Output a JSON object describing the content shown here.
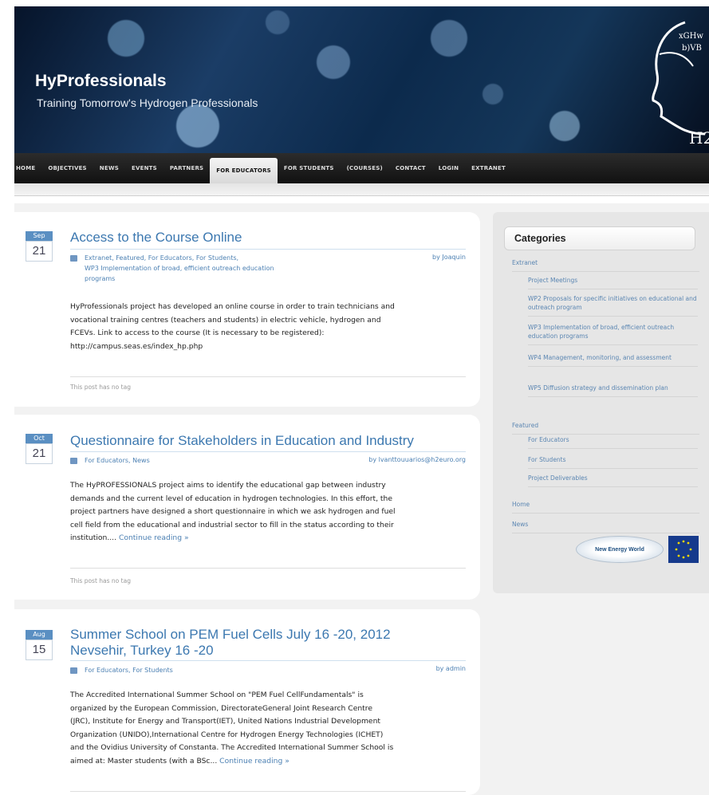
{
  "site": {
    "title": "HyProfessionals",
    "tagline": "Training Tomorrow's Hydrogen Professionals"
  },
  "nav": {
    "items": [
      {
        "label": "HOME",
        "active": false
      },
      {
        "label": "OBJECTIVES",
        "active": false
      },
      {
        "label": "NEWS",
        "active": false
      },
      {
        "label": "EVENTS",
        "active": false
      },
      {
        "label": "PARTNERS",
        "active": false
      },
      {
        "label": "FOR EDUCATORS",
        "active": true
      },
      {
        "label": "FOR STUDENTS",
        "active": false
      },
      {
        "label": "(COURSES)",
        "active": false
      },
      {
        "label": "CONTACT",
        "active": false
      },
      {
        "label": "LOGIN",
        "active": false
      },
      {
        "label": "EXTRANET",
        "active": false
      }
    ]
  },
  "posts": [
    {
      "month": "Sep",
      "day": "21",
      "title": "Access to the Course Online",
      "categories_line1": "Extranet, Featured, For Educators, For Students,",
      "categories_line2": "WP3 Implementation of broad, efficient outreach education",
      "categories_line3": "programs",
      "author": "by Joaquin",
      "body_line1": "HyProfessionals project has developed an online course in order to train technicians and",
      "body_line2": "vocational training centres (teachers and students) in electric vehicle, hydrogen and",
      "body_line3": "FCEVs. Link to access to the course (It is necessary to be registered):",
      "body_line4": "http://campus.seas.es/index_hp.php",
      "tags": "This post has no tag"
    },
    {
      "month": "Oct",
      "day": "21",
      "title": "Questionnaire for Stakeholders in Education and Industry",
      "categories": "For Educators, News",
      "author": "by lvanttouuarios@h2euro.org",
      "body_line1": "The HyPROFESSIONALS project  aims to identify the educational gap between industry",
      "body_line2": "demands and the current level of education in hydrogen technologies. In this effort, the",
      "body_line3": "project partners have designed a short questionnaire in which we ask hydrogen and fuel",
      "body_line4": "cell field from the educational and industrial sector to fill in the status according to their",
      "body_line5": "institution....",
      "more": "Continue reading »",
      "tags": "This post has no tag"
    },
    {
      "month": "Aug",
      "day": "15",
      "title_line1": "Summer School on PEM Fuel Cells July 16 -20, 2012",
      "title_line2": "Nevsehir, Turkey 16 -20",
      "categories": "For Educators, For Students",
      "author": "by admin",
      "body_line1": "The Accredited International Summer School on \"PEM Fuel CellFundamentals\" is",
      "body_line2": "organized by the European Commission, DirectorateGeneral Joint Research Centre",
      "body_line3": "(JRC), Institute for Energy and Transport(IET), United Nations Industrial Development",
      "body_line4": "Organization (UNIDO),International Centre for Hydrogen Energy Technologies (ICHET)",
      "body_line5": "and the Ovidius University of Constanta. The Accredited International Summer School is",
      "body_line6": "aimed at: Master students (with a BSc...",
      "more": "Continue reading »"
    }
  ],
  "sidebar": {
    "title": "Categories",
    "items": [
      "Extranet",
      "Project Meetings",
      "WP2 Proposals for specific initiatives on educational and outreach program",
      "WP3 Implementation of broad, efficient outreach education programs",
      "WP4 Management, monitoring, and assessment",
      "WP5 Diffusion strategy and dissemination plan",
      "Featured",
      "For Educators",
      "For Students",
      "Project Deliverables",
      "Home",
      "News"
    ],
    "logo_text": "New Energy World"
  }
}
